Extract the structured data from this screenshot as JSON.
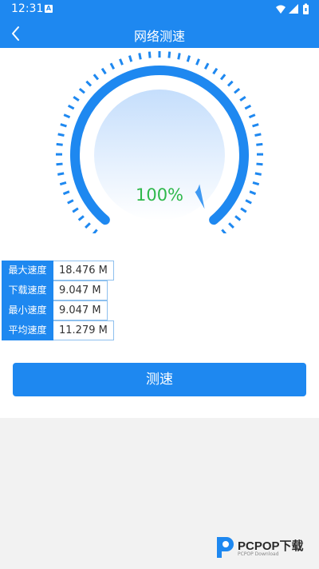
{
  "status_bar": {
    "time": "12:31",
    "notification_icon": "a-icon",
    "icons": [
      "wifi-icon",
      "signal-icon",
      "battery-icon"
    ]
  },
  "header": {
    "title": "网络测速",
    "back_icon": "chevron-left-icon"
  },
  "gauge": {
    "percent": 100,
    "percent_label": "100%"
  },
  "stats": [
    {
      "label": "最大速度",
      "value": "18.476 M"
    },
    {
      "label": "下载速度",
      "value": "9.047 M"
    },
    {
      "label": "最小速度",
      "value": "9.047 M"
    },
    {
      "label": "平均速度",
      "value": "11.279 M"
    }
  ],
  "action": {
    "label": "测速"
  },
  "watermark": {
    "text": "PCPOP下载",
    "sub": "PCPOP Download"
  },
  "colors": {
    "primary": "#1e88f0",
    "success": "#2eb84b"
  }
}
